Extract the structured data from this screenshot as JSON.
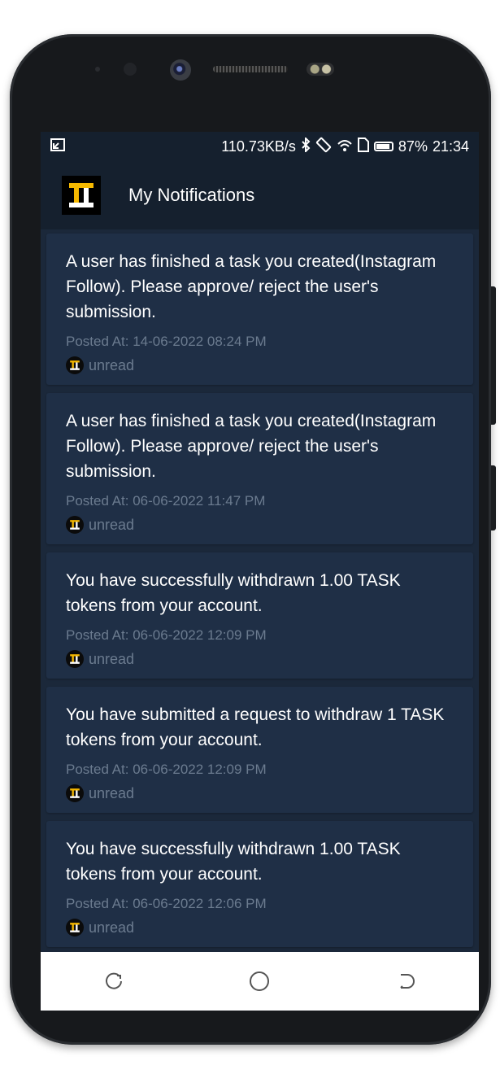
{
  "status_bar": {
    "network_speed": "110.73KB/s",
    "battery": "87%",
    "time": "21:34",
    "icons": [
      "screenshot-icon",
      "bluetooth-icon",
      "rotate-icon",
      "wifi-icon",
      "sim-icon",
      "battery-icon"
    ]
  },
  "app_bar": {
    "title": "My Notifications",
    "logo_icon": "taskitup-logo"
  },
  "colors": {
    "background": "#1b283a",
    "card": "#1f2f46",
    "appbar": "#15202e",
    "accent": "#f5b800",
    "muted_text": "#6b7b8f"
  },
  "notifications": [
    {
      "message": "A user has finished a task you created(Instagram Follow). Please approve/ reject the user's submission.",
      "posted": "Posted At: 14-06-2022 08:24 PM",
      "status": "unread"
    },
    {
      "message": "A user has finished a task you created(Instagram Follow). Please approve/ reject the user's submission.",
      "posted": "Posted At: 06-06-2022 11:47 PM",
      "status": "unread"
    },
    {
      "message": "You have successfully withdrawn 1.00 TASK tokens from your account.",
      "posted": "Posted At: 06-06-2022 12:09 PM",
      "status": "unread"
    },
    {
      "message": "You have submitted a request to withdraw 1 TASK tokens from your account.",
      "posted": "Posted At: 06-06-2022 12:09 PM",
      "status": "unread"
    },
    {
      "message": "You have successfully withdrawn 1.00 TASK tokens from your account.",
      "posted": "Posted At: 06-06-2022 12:06 PM",
      "status": "unread"
    }
  ],
  "nav_bar": {
    "buttons": [
      "recent-apps-icon",
      "home-icon",
      "back-icon"
    ]
  }
}
